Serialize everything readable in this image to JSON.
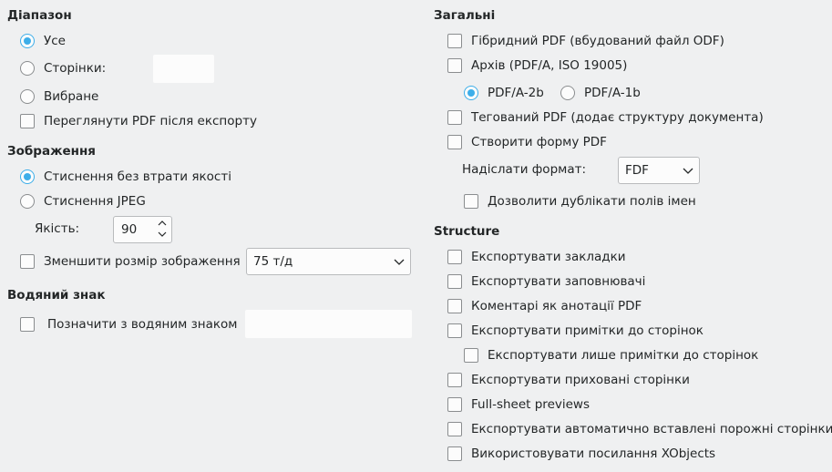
{
  "range": {
    "heading": "Діапазон",
    "all_label": "Усе",
    "pages_label": "Сторінки:",
    "pages_value": "",
    "selection_label": "Вибране",
    "view_pdf_label": "Переглянути PDF після експорту"
  },
  "images": {
    "heading": "Зображення",
    "lossless_label": "Стиснення без втрати якості",
    "jpeg_label": "Стиснення JPEG",
    "quality_label": "Якість:",
    "quality_value": "90",
    "reduce_label": "Зменшити розмір зображення",
    "reduce_value": "75 т/д"
  },
  "watermark": {
    "heading": "Водяний знак",
    "sign_label": "Позначити з водяним знаком",
    "sign_value": ""
  },
  "general": {
    "heading": "Загальні",
    "hybrid_label": "Гібридний PDF (вбудований файл ODF)",
    "archive_label": "Архів (PDF/A, ISO 19005)",
    "pdfa2b_label": "PDF/A-2b",
    "pdfa1b_label": "PDF/A-1b",
    "tagged_label": "Тегований PDF (додає структуру документа)",
    "form_label": "Створити форму PDF",
    "submit_format_label": "Надіслати формат:",
    "submit_format_value": "FDF",
    "allow_duplicates_label": "Дозволити дублікати полів імен"
  },
  "structure": {
    "heading": "Structure",
    "bookmarks_label": "Експортувати закладки",
    "placeholders_label": "Експортувати заповнювачі",
    "comments_label": "Коментарі як анотації PDF",
    "notes_label": "Експортувати примітки до сторінок",
    "notes_only_label": "Експортувати лише примітки до сторінок",
    "hidden_label": "Експортувати приховані сторінки",
    "fullsheet_label": "Full-sheet previews",
    "empty_pages_label": "Експортувати автоматично вставлені порожні сторінки",
    "xobjects_label": "Використовувати посилання XObjects"
  },
  "colors": {
    "accent": "#3daee9",
    "background": "#eff0f1",
    "field": "#fcfcfc"
  }
}
